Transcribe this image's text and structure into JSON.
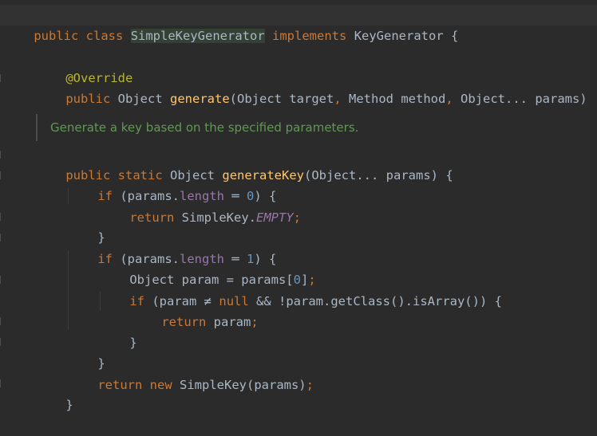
{
  "editor": {
    "language": "Java",
    "theme_colors": {
      "background": "#2b2b2b",
      "keyword": "#cc7832",
      "function": "#ffc66d",
      "annotation": "#bbb529",
      "number": "#6897bb",
      "field": "#9876aa",
      "text": "#a9b7c6",
      "doc": "#629755"
    },
    "lines": {
      "l1": {
        "kw_public": "public",
        "kw_class": "class",
        "class_name": "SimpleKeyGenerator",
        "kw_implements": "implements",
        "iface": "KeyGenerator",
        "brace": "{"
      },
      "l2": {
        "annotation": "@Override"
      },
      "l3": {
        "kw_public": "public",
        "ret_type": "Object",
        "method": "generate",
        "p1": "(Object target",
        "c1": ",",
        "p2": " Method method",
        "c2": ",",
        "p3": " Object... params)"
      },
      "doc": {
        "text": "Generate a key based on the specified parameters."
      },
      "l4": {
        "kw_public": "public",
        "kw_static": "static",
        "ret_type": "Object",
        "method": "generateKey",
        "params": "(Object... params) {"
      },
      "l5": {
        "kw_if": "if",
        "open": "(params.",
        "field": "length",
        "op": " ═ ",
        "num": "0",
        "close": ") {"
      },
      "l6": {
        "kw_return": "return",
        "cls": "SimpleKey.",
        "sfield": "EMPTY",
        "semi": ";"
      },
      "l7": {
        "brace": "}"
      },
      "l8": {
        "kw_if": "if",
        "open": "(params.",
        "field": "length",
        "op": " ═ ",
        "num": "1",
        "close": ") {"
      },
      "l9": {
        "decl": "Object param = params[",
        "num": "0",
        "close": "]",
        "semi": ";"
      },
      "l10": {
        "kw_if": "if",
        "open": "(param ",
        "op": "≠",
        "space": " ",
        "kw_null": "null",
        "rest": " && !param.getClass().isArray()) {"
      },
      "l11": {
        "kw_return": "return",
        "val": " param",
        "semi": ";"
      },
      "l12": {
        "brace": "}"
      },
      "l13": {
        "brace": "}"
      },
      "l14": {
        "kw_return": "return",
        "kw_new": "new",
        "call": " SimpleKey(params)",
        "semi": ";"
      },
      "l15": {
        "brace": "}"
      }
    }
  }
}
